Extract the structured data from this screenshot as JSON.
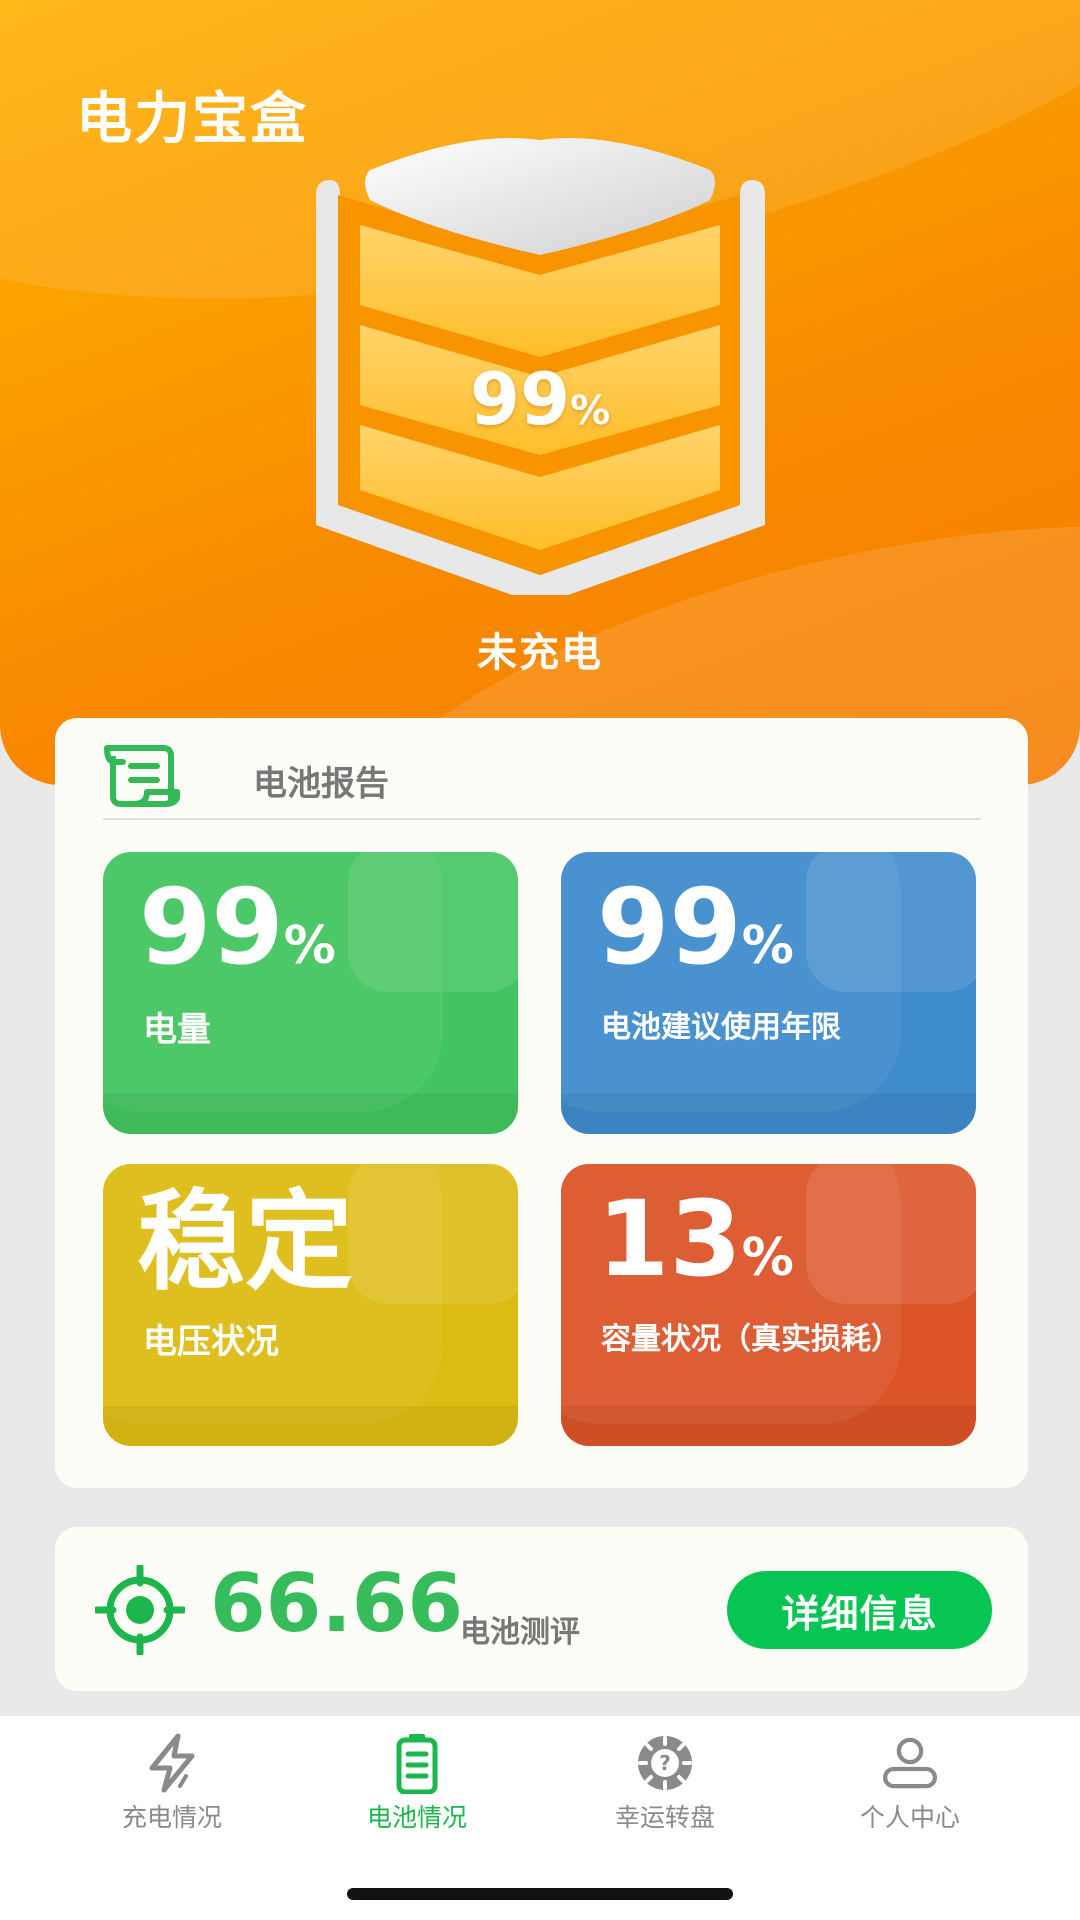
{
  "header": {
    "app_title": "电力宝盒",
    "battery_percent": "99",
    "percent_sign": "%",
    "charge_status": "未充电"
  },
  "report": {
    "title": "电池报告",
    "tiles": [
      {
        "value": "99",
        "unit": "%",
        "label": "电量",
        "color": "#42c560"
      },
      {
        "value": "99",
        "unit": "%",
        "label": "电池建议使用年限",
        "color": "#3f8ccc"
      },
      {
        "value": "稳定",
        "unit": "",
        "label": "电压状况",
        "color": "#dcbb12"
      },
      {
        "value": "13",
        "unit": "%",
        "label": "容量状况（真实损耗）",
        "color": "#db5428"
      }
    ]
  },
  "score": {
    "value": "66.66",
    "label": "电池测评",
    "button_label": "详细信息",
    "accent": "#06c552"
  },
  "tabs": [
    {
      "label": "充电情况",
      "icon": "lightning-icon",
      "active": false
    },
    {
      "label": "电池情况",
      "icon": "battery-icon",
      "active": true
    },
    {
      "label": "幸运转盘",
      "icon": "roulette-wheel-icon",
      "active": false
    },
    {
      "label": "个人中心",
      "icon": "user-icon",
      "active": false
    }
  ]
}
